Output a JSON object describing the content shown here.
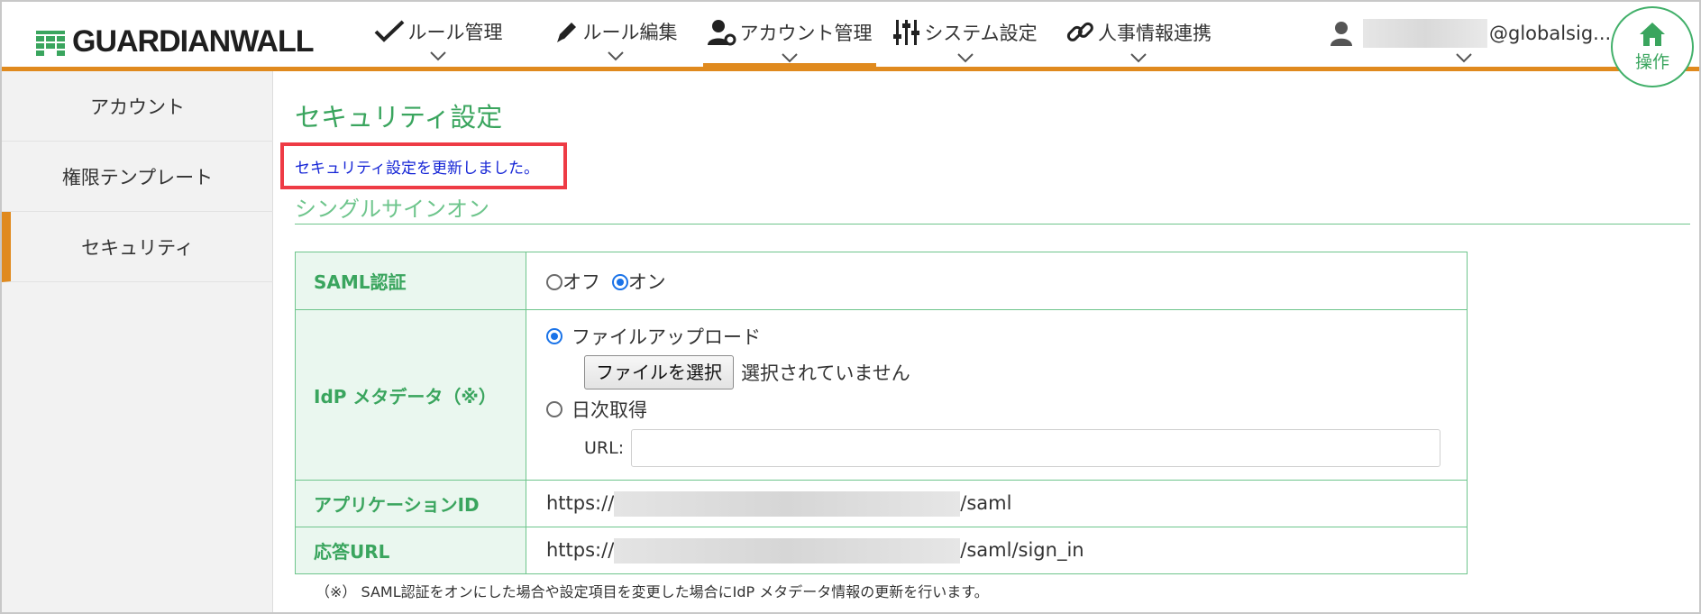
{
  "header": {
    "logo_text": "GUARDIANWALL",
    "nav": [
      {
        "label": "ルール管理"
      },
      {
        "label": "ルール編集"
      },
      {
        "label": "アカウント管理"
      },
      {
        "label": "システム設定"
      },
      {
        "label": "人事情報連携"
      }
    ],
    "active_nav": "アカウント管理",
    "user_email_suffix": "@globalsig...",
    "ops_label": "操作"
  },
  "sidebar": {
    "items": [
      {
        "label": "アカウント"
      },
      {
        "label": "権限テンプレート"
      },
      {
        "label": "セキュリティ"
      }
    ],
    "active_item": "セキュリティ"
  },
  "main": {
    "page_title": "セキュリティ設定",
    "notice": "セキュリティ設定を更新しました。",
    "section_title": "シングルサインオン",
    "table": {
      "saml_label": "SAML認証",
      "saml_off": "オフ",
      "saml_on": "オン",
      "saml_selected": "オン",
      "idp_label": "IdP メタデータ（※）",
      "idp_upload_option": "ファイルアップロード",
      "file_button": "ファイルを選択",
      "file_status": "選択されていません",
      "idp_daily_option": "日次取得",
      "url_label": "URL:",
      "url_value": "",
      "idp_selected": "ファイルアップロード",
      "app_id_label": "アプリケーションID",
      "app_id_prefix": "https://",
      "app_id_suffix": "/saml",
      "response_url_label": "応答URL",
      "response_url_prefix": "https://",
      "response_url_suffix": "/saml/sign_in"
    },
    "footnote": "（※） SAML認証をオンにした場合や設定項目を変更した場合にIdP メタデータ情報の更新を行います。"
  },
  "colors": {
    "accent_orange": "#e08a1e",
    "brand_green": "#3aa55e",
    "notice_blue": "#1525d6",
    "highlight_red": "#ee3b45"
  }
}
